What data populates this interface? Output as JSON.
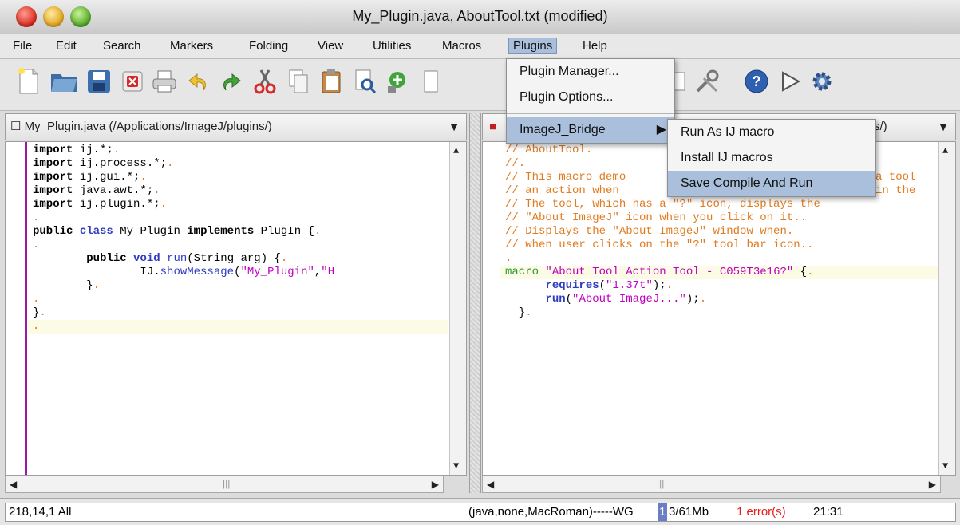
{
  "window": {
    "title": "My_Plugin.java, AboutTool.txt (modified)"
  },
  "menubar": {
    "items": [
      "File",
      "Edit",
      "Search",
      "Markers",
      "Folding",
      "View",
      "Utilities",
      "Macros",
      "Plugins",
      "Help"
    ],
    "active": "Plugins"
  },
  "plugins_menu": {
    "items": [
      "Plugin Manager...",
      "Plugin Options...",
      "ImageJ_Bridge"
    ]
  },
  "submenu": {
    "items": [
      "Run As IJ macro",
      "Install IJ macros",
      "Save Compile And Run"
    ],
    "highlighted": "Save Compile And Run"
  },
  "left_panel": {
    "header": "My_Plugin.java (/Applications/ImageJ/plugins/)",
    "lines": [
      "import ij.*;",
      "import ij.process.*;",
      "import ij.gui.*;",
      "import java.awt.*;",
      "import ij.plugin.*;",
      "",
      "public class My_Plugin implements PlugIn {",
      "",
      "        public void run(String arg) {",
      "                IJ.showMessage(\"My_Plugin\",\"H",
      "        }",
      "",
      "}",
      ""
    ]
  },
  "right_panel": {
    "header_suffix": "s/)",
    "lines": [
      "// AboutTool.",
      "//.",
      "// This macro demo",
      "// an action when",
      "// The tool, which has a \"?\" icon, displays the",
      "// \"About ImageJ\" icon when you click on it..",
      "// Displays the \"About ImageJ\" window when.",
      "// when user clicks on the \"?\" tool bar icon..",
      "",
      "macro \"About Tool Action Tool - C059T3e16?\" {.",
      "      requires(\"1.37t\");.",
      "      run(\"About ImageJ...\");.",
      "  }."
    ],
    "partial_text": {
      "line3_tail": "a tool",
      "line4_tail": "in the"
    }
  },
  "status": {
    "position": "218,14,1 All",
    "mode": "(java,none,MacRoman)-----WG",
    "memory_used": "1",
    "memory": "3/61Mb",
    "errors": "1 error(s)",
    "time": "21:31"
  },
  "colors": {
    "accent": "#a9bfdc",
    "error": "#e02020",
    "comment": "#e07b1f",
    "macro": "#2a9a2a"
  }
}
